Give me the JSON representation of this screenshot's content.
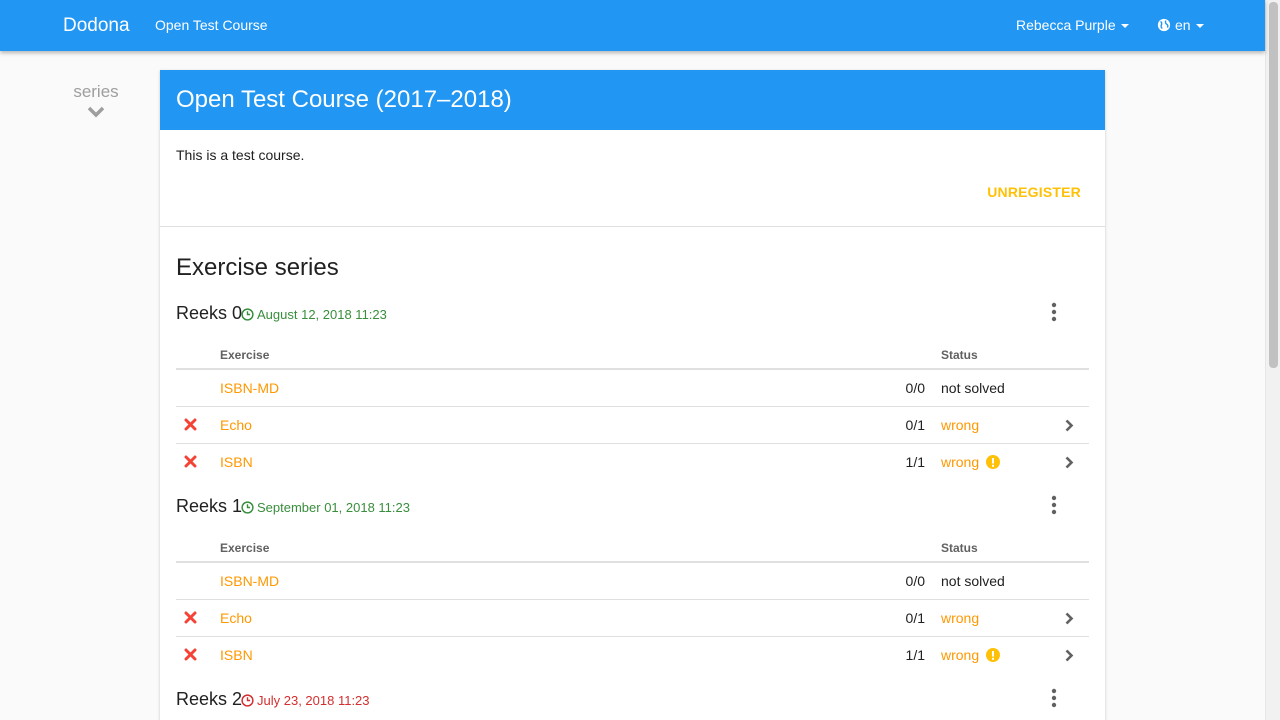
{
  "navbar": {
    "brand": "Dodona",
    "course_link": "Open Test Course",
    "user": "Rebecca Purple",
    "language": "en"
  },
  "toc": {
    "label": "series"
  },
  "course": {
    "title": "Open Test Course (2017–2018)",
    "description": "This is a test course.",
    "unregister_label": "UNREGISTER"
  },
  "section_title": "Exercise series",
  "table_headers": {
    "exercise": "Exercise",
    "status": "Status"
  },
  "series": [
    {
      "name": "Reeks 0",
      "deadline": "August 12, 2018 11:23",
      "deadline_state": "upcoming",
      "exercises": [
        {
          "name": "ISBN-MD",
          "score": "0/0",
          "status": "not solved",
          "wrong": false,
          "warning": false
        },
        {
          "name": "Echo",
          "score": "0/1",
          "status": "wrong",
          "wrong": true,
          "warning": false
        },
        {
          "name": "ISBN",
          "score": "1/1",
          "status": "wrong",
          "wrong": true,
          "warning": true
        }
      ]
    },
    {
      "name": "Reeks 1",
      "deadline": "September 01, 2018 11:23",
      "deadline_state": "upcoming",
      "exercises": [
        {
          "name": "ISBN-MD",
          "score": "0/0",
          "status": "not solved",
          "wrong": false,
          "warning": false
        },
        {
          "name": "Echo",
          "score": "0/1",
          "status": "wrong",
          "wrong": true,
          "warning": false
        },
        {
          "name": "ISBN",
          "score": "1/1",
          "status": "wrong",
          "wrong": true,
          "warning": true
        }
      ]
    },
    {
      "name": "Reeks 2",
      "deadline": "July 23, 2018 11:23",
      "deadline_state": "passed",
      "exercises": []
    }
  ],
  "colors": {
    "primary": "#2196f3",
    "accent": "#ff9800",
    "unregister": "#ffc107",
    "deadline_upcoming": "#388e3c",
    "deadline_passed": "#d32f2f",
    "wrong_icon": "#f44336"
  }
}
